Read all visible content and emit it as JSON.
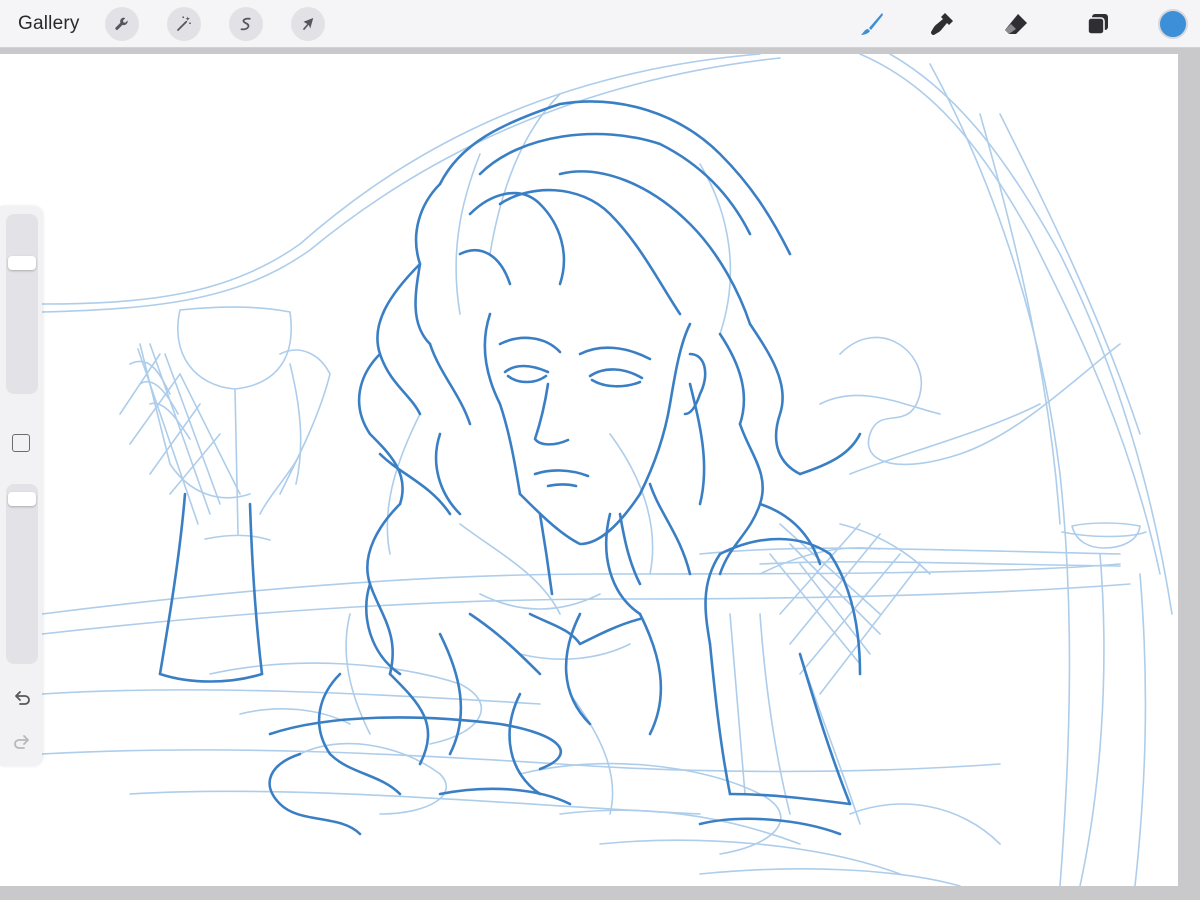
{
  "toolbar": {
    "gallery_label": "Gallery",
    "left_tools": [
      {
        "name": "actions",
        "icon": "wrench-icon"
      },
      {
        "name": "adjustments",
        "icon": "magic-wand-icon"
      },
      {
        "name": "selection",
        "icon": "selection-s-icon"
      },
      {
        "name": "transform",
        "icon": "arrow-cursor-icon"
      }
    ],
    "right_tools": [
      {
        "name": "brush",
        "icon": "brush-icon",
        "active": true
      },
      {
        "name": "smudge",
        "icon": "smudge-icon",
        "active": false
      },
      {
        "name": "eraser",
        "icon": "eraser-icon",
        "active": false
      },
      {
        "name": "layers",
        "icon": "layers-icon",
        "active": false
      }
    ],
    "current_color": "#3d8fd8"
  },
  "sidebar": {
    "brush_size_level": 0.25,
    "opacity_level": 0.05,
    "icons": [
      "undo-icon",
      "redo-icon",
      "modify-square-icon"
    ]
  },
  "canvas": {
    "stroke_dark": "#3a7fc4",
    "stroke_light": "#a9cbea"
  }
}
